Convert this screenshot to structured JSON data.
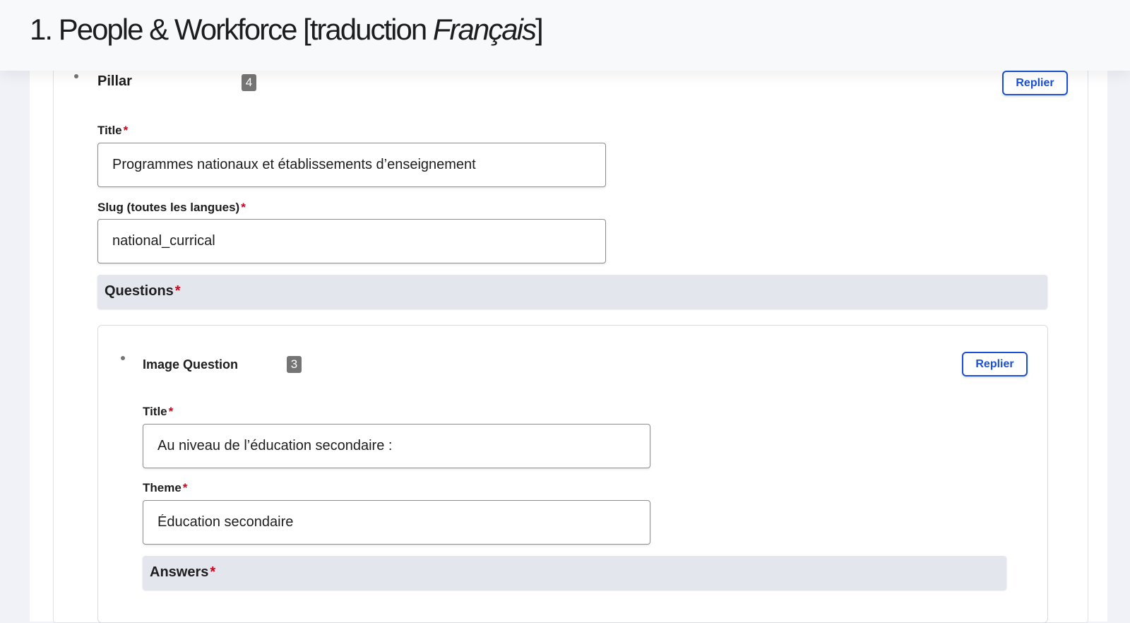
{
  "header": {
    "title_prefix": "1. People & Workforce [traduction ",
    "title_lang": "Français",
    "title_suffix": "]"
  },
  "pillar": {
    "label": "Pillar",
    "count": "4",
    "collapse_label": "Replier",
    "title_field": {
      "label": "Title",
      "required": "*",
      "value": "Programmes nationaux et établissements d’enseignement"
    },
    "slug_field": {
      "label": "Slug (toutes les langues)",
      "required": "*",
      "value": "national_currical"
    },
    "questions_section": {
      "label": "Questions",
      "required": "*"
    }
  },
  "question": {
    "label": "Image Question",
    "count": "3",
    "collapse_label": "Replier",
    "title_field": {
      "label": "Title",
      "required": "*",
      "value": "Au niveau de l’éducation secondaire :"
    },
    "theme_field": {
      "label": "Theme",
      "required": "*",
      "value": "Éducation secondaire"
    },
    "answers_section": {
      "label": "Answers",
      "required": "*"
    }
  },
  "colors": {
    "accent": "#1a4fd6",
    "required": "#d0021b",
    "badge": "#757575",
    "section_bar": "#e4e6ee"
  }
}
